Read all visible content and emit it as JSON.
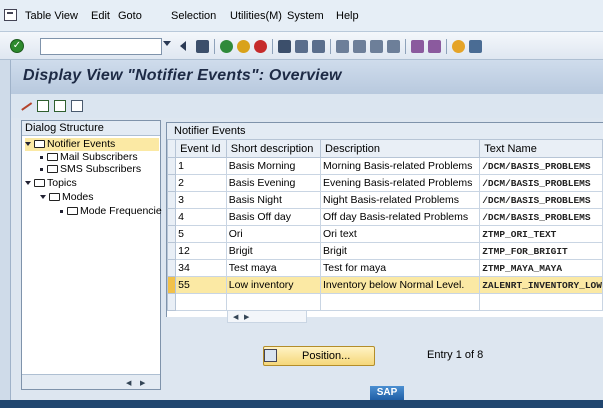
{
  "menu": {
    "items": [
      "Table View",
      "Edit",
      "Goto",
      "Selection",
      "Utilities(M)",
      "System",
      "Help"
    ]
  },
  "toolbar": {
    "command_value": "",
    "icons": [
      "ok-icon",
      "back-icon",
      "save-icon",
      "exit-icon",
      "cancel-icon",
      "print-icon",
      "find-icon",
      "find-next-icon",
      "first-page-icon",
      "prev-page-icon",
      "next-page-icon",
      "last-page-icon",
      "create-session-icon",
      "shortcut-icon",
      "help-icon",
      "layout-icon"
    ]
  },
  "title": "Display View \"Notifier Events\": Overview",
  "app_toolbar": {
    "icons": [
      "display-change-icon",
      "new-entries-icon",
      "copy-icon",
      "delete-icon"
    ]
  },
  "dialog_structure": {
    "header": "Dialog Structure",
    "items": [
      {
        "label": "Notifier Events",
        "level": 0,
        "expanded": true,
        "selected": true
      },
      {
        "label": "Mail Subscribers",
        "level": 1
      },
      {
        "label": "SMS Subscribers",
        "level": 1
      },
      {
        "label": "Topics",
        "level": 0,
        "expanded": true
      },
      {
        "label": "Modes",
        "level": 1,
        "expanded": true
      },
      {
        "label": "Mode Frequencie",
        "level": 2
      }
    ]
  },
  "table": {
    "title": "Notifier Events",
    "columns": [
      "Event Id",
      "Short description",
      "Description",
      "Text Name"
    ],
    "rows": [
      {
        "id": "1",
        "short": "Basis Morning",
        "desc": "Morning Basis-related Problems",
        "text_name": "/DCM/BASIS_PROBLEMS"
      },
      {
        "id": "2",
        "short": "Basis Evening",
        "desc": "Evening Basis-related Problems",
        "text_name": "/DCM/BASIS_PROBLEMS"
      },
      {
        "id": "3",
        "short": "Basis Night",
        "desc": "Night Basis-related Problems",
        "text_name": "/DCM/BASIS_PROBLEMS"
      },
      {
        "id": "4",
        "short": "Basis Off day",
        "desc": "Off day Basis-related Problems",
        "text_name": "/DCM/BASIS_PROBLEMS"
      },
      {
        "id": "5",
        "short": "Ori",
        "desc": "Ori text",
        "text_name": "ZTMP_ORI_TEXT"
      },
      {
        "id": "12",
        "short": "Brigit",
        "desc": "Brigit",
        "text_name": "ZTMP_FOR_BRIGIT"
      },
      {
        "id": "34",
        "short": "Test maya",
        "desc": "Test for maya",
        "text_name": "ZTMP_MAYA_MAYA"
      },
      {
        "id": "55",
        "short": "Low inventory",
        "desc": "Inventory below Normal Level.",
        "text_name": "ZALENRT_INVENTORY_LOW",
        "highlighted": true
      }
    ]
  },
  "position_button": "Position...",
  "entry_info": "Entry 1 of 8",
  "logo": "SAP",
  "colors": {
    "accent": "#fbe9a4",
    "title_bg": "#c4d3e6",
    "status_bar": "#21466f"
  }
}
